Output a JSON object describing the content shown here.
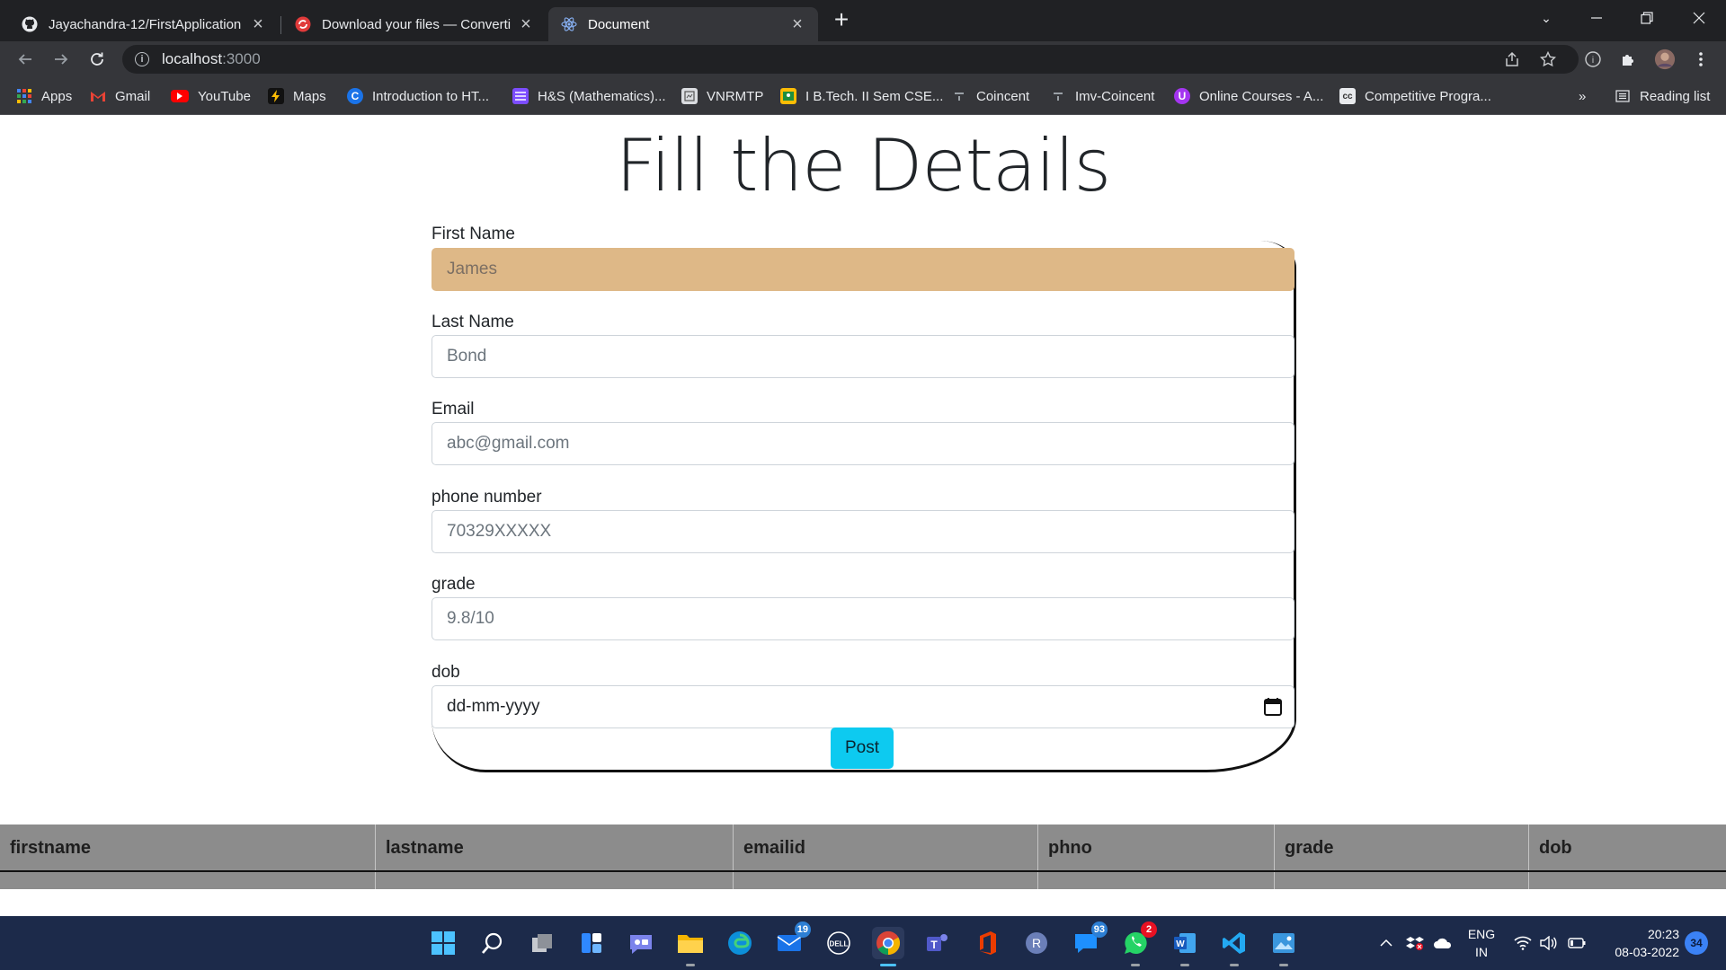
{
  "browser": {
    "tabs": [
      {
        "title": "Jayachandra-12/FirstApplication",
        "icon": "github-icon"
      },
      {
        "title": "Download your files — Convertio",
        "icon": "convertio-icon"
      },
      {
        "title": "Document",
        "icon": "react-icon"
      }
    ],
    "url_host": "localhost",
    "url_port": ":3000",
    "bookmarks": [
      "Apps",
      "Gmail",
      "YouTube",
      "Maps",
      "Introduction to HT...",
      "H&S (Mathematics)...",
      "VNRMTP",
      "I B.Tech. II Sem CSE...",
      "Coincent",
      "Imv-Coincent",
      "Online Courses - A...",
      "Competitive Progra..."
    ],
    "more_bookmarks": "»",
    "reading_list": "Reading list"
  },
  "page": {
    "title": "Fill the Details",
    "fields": [
      {
        "label": "First Name",
        "placeholder": "James"
      },
      {
        "label": "Last Name",
        "placeholder": "Bond"
      },
      {
        "label": "Email",
        "placeholder": "abc@gmail.com"
      },
      {
        "label": "phone number",
        "placeholder": "70329XXXXX"
      },
      {
        "label": "grade",
        "placeholder": "9.8/10"
      },
      {
        "label": "dob",
        "placeholder": "dd-mm-yyyy"
      }
    ],
    "submit_label": "Post",
    "table_headers": [
      "firstname",
      "lastname",
      "emailid",
      "phno",
      "grade",
      "dob"
    ]
  },
  "taskbar": {
    "badges": {
      "mail": "19",
      "messages": "93",
      "whatsapp": "2",
      "notifications": "34"
    },
    "language": "ENG",
    "region": "IN",
    "time": "20:23",
    "date": "08-03-2022"
  },
  "colors": {
    "accent_button": "#0dcaf0",
    "focused_input": "#deb887",
    "table_header_bg": "#8c8c8c"
  }
}
